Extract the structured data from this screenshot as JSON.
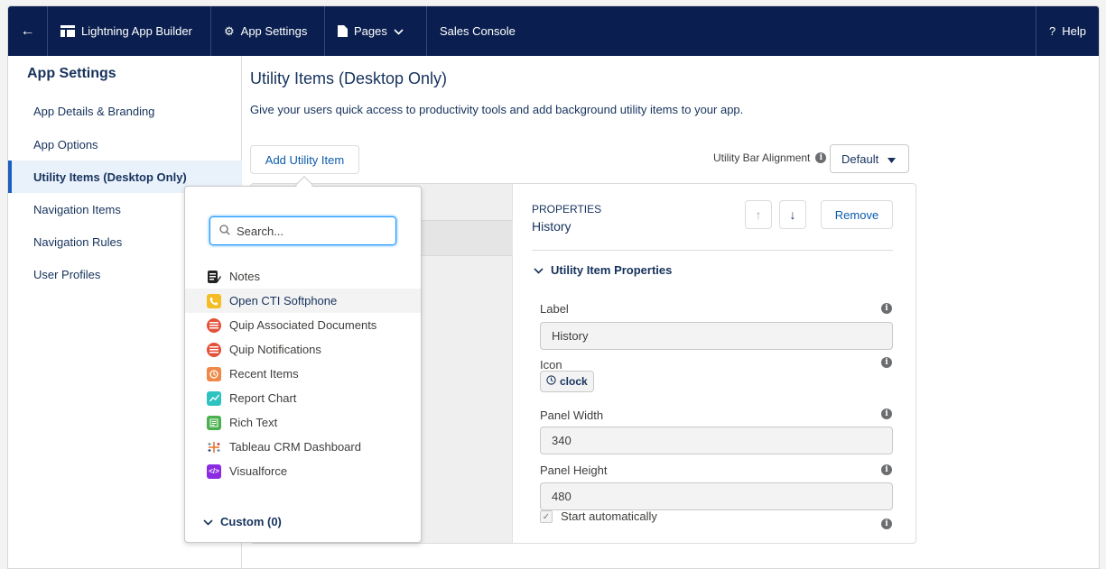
{
  "topbar": {
    "back_icon": "back-arrow-icon",
    "app_builder": "Lightning App Builder",
    "app_settings": "App Settings",
    "pages": "Pages",
    "app_name": "Sales Console",
    "help": "Help"
  },
  "sidebar": {
    "title": "App Settings",
    "items": [
      {
        "label": "App Details & Branding"
      },
      {
        "label": "App Options"
      },
      {
        "label": "Utility Items (Desktop Only)"
      },
      {
        "label": "Navigation Items"
      },
      {
        "label": "Navigation Rules"
      },
      {
        "label": "User Profiles"
      }
    ]
  },
  "main": {
    "title": "Utility Items (Desktop Only)",
    "description": "Give your users quick access to productivity tools and add background utility items to your app.",
    "add_button": "Add Utility Item",
    "alignment_label": "Utility Bar Alignment",
    "alignment_value": "Default"
  },
  "dropdown": {
    "search_placeholder": "Search...",
    "items": [
      {
        "label": "Notes",
        "icon": "notes-icon",
        "color": "#222222"
      },
      {
        "label": "Open CTI Softphone",
        "icon": "phone-icon",
        "color": "#f4bc25"
      },
      {
        "label": "Quip Associated Documents",
        "icon": "quip-icon",
        "color": "#e4513a"
      },
      {
        "label": "Quip Notifications",
        "icon": "quip-icon",
        "color": "#e4513a"
      },
      {
        "label": "Recent Items",
        "icon": "clock-icon",
        "color": "#f08848"
      },
      {
        "label": "Report Chart",
        "icon": "report-chart-icon",
        "color": "#2ec3c1"
      },
      {
        "label": "Rich Text",
        "icon": "rich-text-icon",
        "color": "#4bb04f"
      },
      {
        "label": "Tableau CRM Dashboard",
        "icon": "tableau-icon",
        "color": "#e97627"
      },
      {
        "label": "Visualforce",
        "icon": "code-icon",
        "color": "#8b2ce3"
      }
    ],
    "custom_label": "Custom (0)"
  },
  "properties": {
    "heading": "PROPERTIES",
    "name": "History",
    "remove_button": "Remove",
    "section_title": "Utility Item Properties",
    "label_field": {
      "label": "Label",
      "value": "History"
    },
    "icon_field": {
      "label": "Icon",
      "value": "clock"
    },
    "panel_width": {
      "label": "Panel Width",
      "value": "340"
    },
    "panel_height": {
      "label": "Panel Height",
      "value": "480"
    },
    "start_auto": {
      "label": "Start automatically",
      "checked": true
    }
  },
  "colors": {
    "topbar": "#0a1f4f",
    "accent": "#0b5cab",
    "active_sidebar": "#e9f1fb"
  }
}
